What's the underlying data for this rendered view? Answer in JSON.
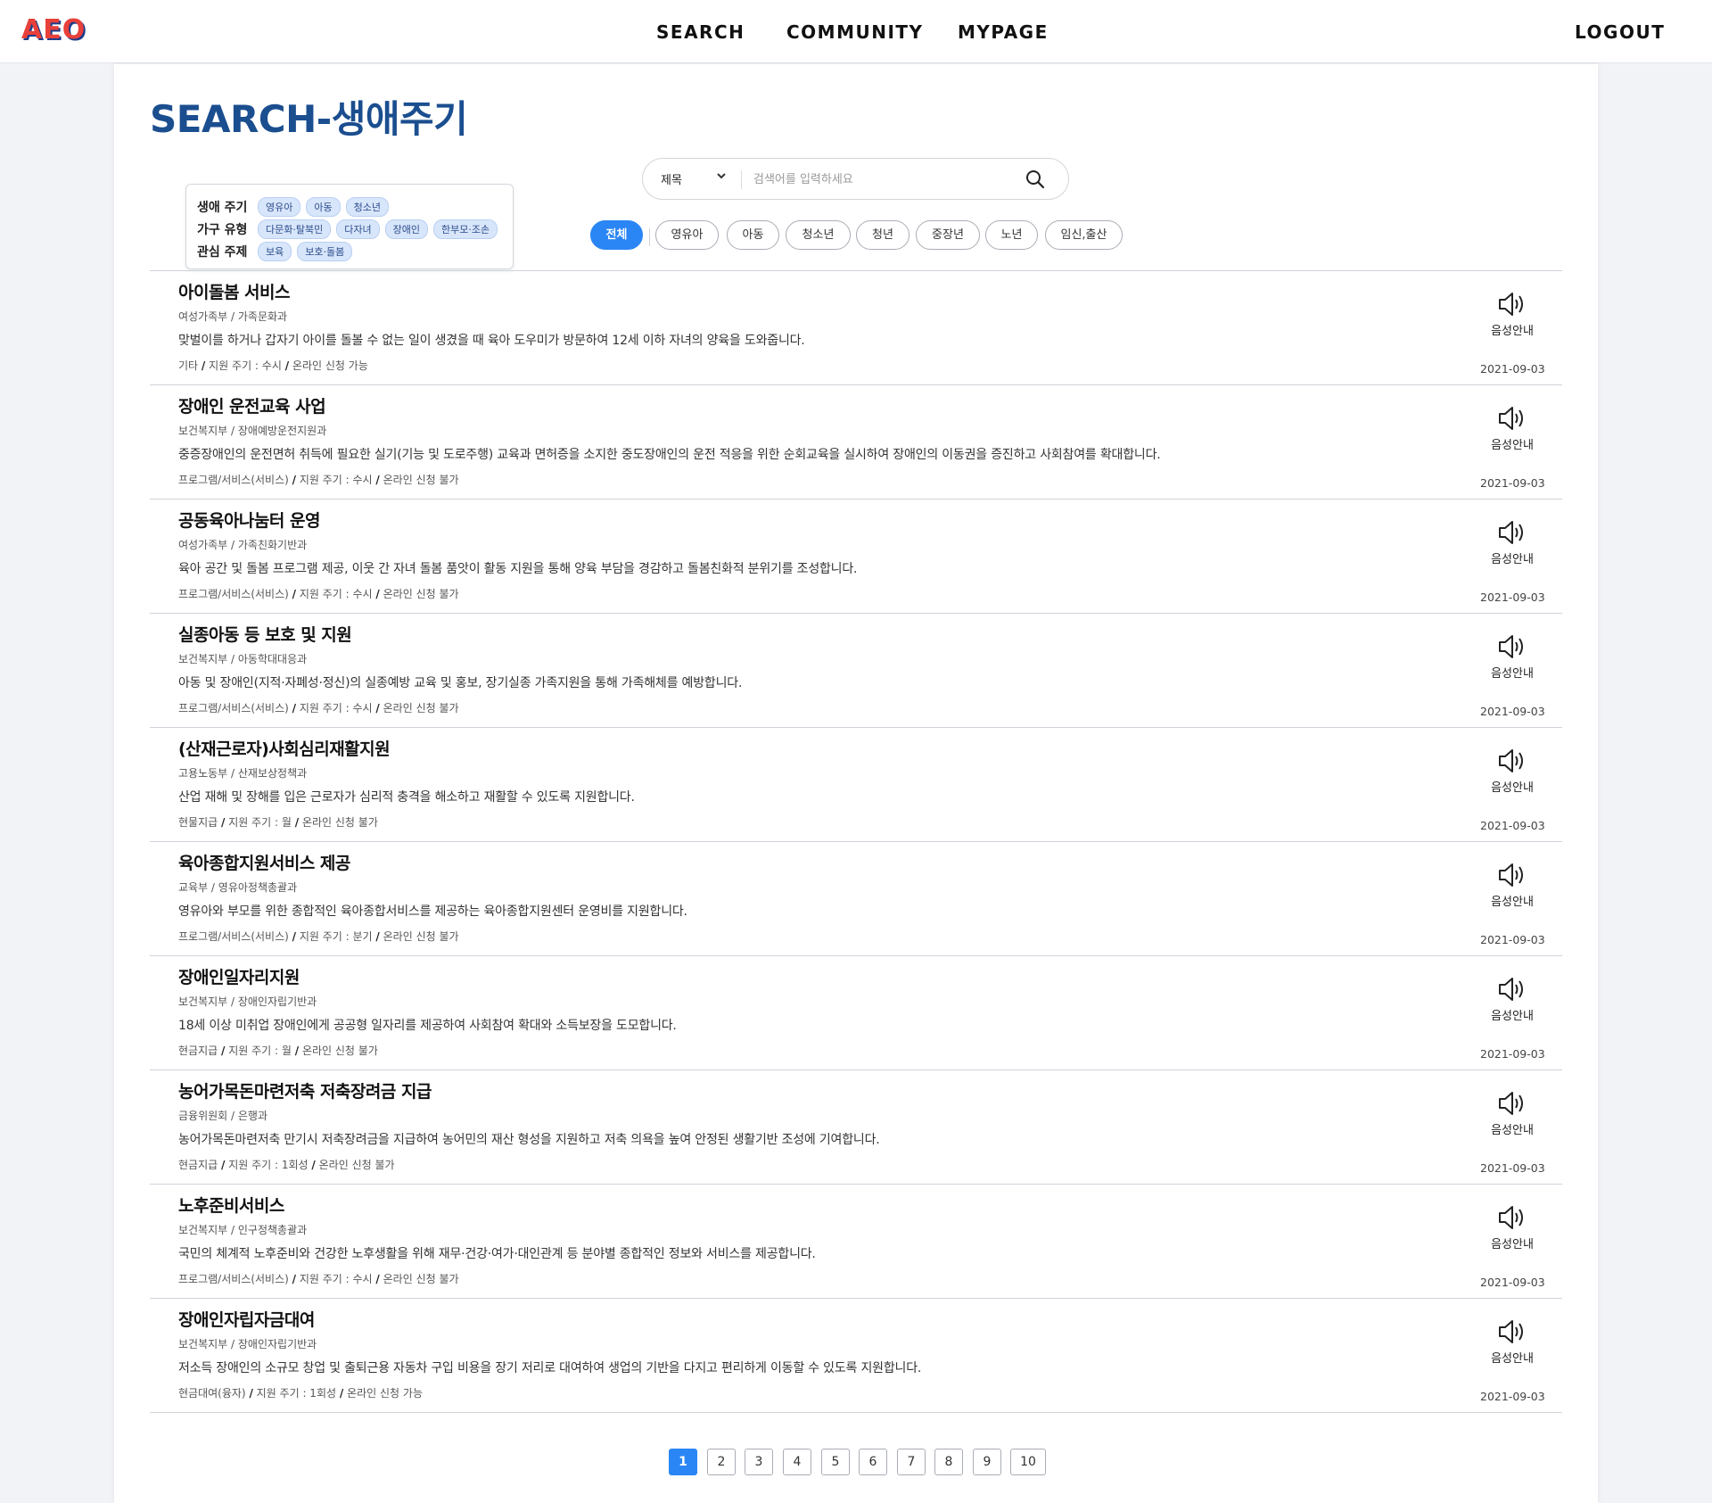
{
  "header": {
    "logo": "AEO",
    "nav": {
      "search": "SEARCH",
      "community": "COMMUNITY",
      "mypage": "MYPAGE",
      "logout": "LOGOUT"
    }
  },
  "page": {
    "title": "SEARCH-생애주기"
  },
  "filter_card": {
    "rows": [
      {
        "label": "생애 주기",
        "tags": [
          "영유아",
          "아동",
          "청소년"
        ]
      },
      {
        "label": "가구 유형",
        "tags": [
          "다문화·탈북민",
          "다자녀",
          "장애인",
          "한부모·조손"
        ]
      },
      {
        "label": "관심 주제",
        "tags": [
          "보육",
          "보호·돌봄"
        ]
      }
    ]
  },
  "search": {
    "select_value": "제목",
    "placeholder": "검색어를 입력하세요"
  },
  "categories": [
    "전체",
    "영유아",
    "아동",
    "청소년",
    "청년",
    "중장년",
    "노년",
    "임신,출산"
  ],
  "active_category": "전체",
  "voice_label": "음성안내",
  "results": [
    {
      "title": "아이돌봄 서비스",
      "dept": "여성가족부 / 가족문화과",
      "desc": "맞벌이를 하거나 갑자기 아이를 돌볼 수 없는 일이 생겼을 때 육아 도우미가 방문하여 12세 이하 자녀의 양육을 도와줍니다.",
      "type": "기타",
      "cycle": "지원 주기 : 수시",
      "online": "온라인 신청 가능",
      "date": "2021-09-03"
    },
    {
      "title": "장애인 운전교육 사업",
      "dept": "보건복지부 / 장애예방운전지원과",
      "desc": "중증장애인의 운전면허 취득에 필요한 실기(기능 및 도로주행) 교육과 면허증을 소지한 중도장애인의 운전 적응을 위한 순회교육을 실시하여 장애인의 이동권을 증진하고 사회참여를 확대합니다.",
      "type": "프로그램/서비스(서비스)",
      "cycle": "지원 주기 : 수시",
      "online": "온라인 신청 불가",
      "date": "2021-09-03"
    },
    {
      "title": "공동육아나눔터 운영",
      "dept": "여성가족부 / 가족친화기반과",
      "desc": "육아 공간 및 돌봄 프로그램 제공, 이웃 간 자녀 돌봄 품앗이 활동 지원을 통해 양육 부담을 경감하고 돌봄친화적 분위기를 조성합니다.",
      "type": "프로그램/서비스(서비스)",
      "cycle": "지원 주기 : 수시",
      "online": "온라인 신청 불가",
      "date": "2021-09-03"
    },
    {
      "title": "실종아동 등 보호 및 지원",
      "dept": "보건복지부 / 아동학대대응과",
      "desc": "아동 및 장애인(지적·자폐성·정신)의 실종예방 교육 및 홍보, 장기실종 가족지원을 통해 가족해체를 예방합니다.",
      "type": "프로그램/서비스(서비스)",
      "cycle": "지원 주기 : 수시",
      "online": "온라인 신청 불가",
      "date": "2021-09-03"
    },
    {
      "title": "(산재근로자)사회심리재활지원",
      "dept": "고용노동부 / 산재보상정책과",
      "desc": "산업 재해 및 장해를 입은 근로자가 심리적 충격을 해소하고 재활할 수 있도록 지원합니다.",
      "type": "현물지급",
      "cycle": "지원 주기 : 월",
      "online": "온라인 신청 불가",
      "date": "2021-09-03"
    },
    {
      "title": "육아종합지원서비스 제공",
      "dept": "교육부 / 영유아정책총괄과",
      "desc": "영유아와 부모를 위한 종합적인 육아종합서비스를 제공하는 육아종합지원센터 운영비를 지원합니다.",
      "type": "프로그램/서비스(서비스)",
      "cycle": "지원 주기 : 분기",
      "online": "온라인 신청 불가",
      "date": "2021-09-03"
    },
    {
      "title": "장애인일자리지원",
      "dept": "보건복지부 / 장애인자립기반과",
      "desc": "18세 이상 미취업 장애인에게 공공형 일자리를 제공하여 사회참여 확대와 소득보장을 도모합니다.",
      "type": "현금지급",
      "cycle": "지원 주기 : 월",
      "online": "온라인 신청 불가",
      "date": "2021-09-03"
    },
    {
      "title": "농어가목돈마련저축 저축장려금 지급",
      "dept": "금융위원회 / 은행과",
      "desc": "농어가목돈마련저축 만기시 저축장려금을 지급하여 농어민의 재산 형성을 지원하고 저축 의욕을 높여 안정된 생활기반 조성에 기여합니다.",
      "type": "현금지급",
      "cycle": "지원 주기 : 1회성",
      "online": "온라인 신청 불가",
      "date": "2021-09-03"
    },
    {
      "title": "노후준비서비스",
      "dept": "보건복지부 / 인구정책총괄과",
      "desc": "국민의 체계적 노후준비와 건강한 노후생활을 위해 재무·건강·여가·대인관계 등 분야별 종합적인 정보와 서비스를 제공합니다.",
      "type": "프로그램/서비스(서비스)",
      "cycle": "지원 주기 : 수시",
      "online": "온라인 신청 불가",
      "date": "2021-09-03"
    },
    {
      "title": "장애인자립자금대여",
      "dept": "보건복지부 / 장애인자립기반과",
      "desc": "저소득 장애인의 소규모 창업 및 출퇴근용 자동차 구입 비용을 장기 저리로 대여하여 생업의 기반을 다지고 편리하게 이동할 수 있도록 지원합니다.",
      "type": "현금대여(융자)",
      "cycle": "지원 주기 : 1회성",
      "online": "온라인 신청 가능",
      "date": "2021-09-03"
    }
  ],
  "pagination": {
    "pages": [
      "1",
      "2",
      "3",
      "4",
      "5",
      "6",
      "7",
      "8",
      "9",
      "10"
    ],
    "current": "1"
  },
  "colors": {
    "accent": "#2b86f5",
    "title": "#1b4e8f",
    "logo_red": "#e8403a",
    "logo_blue": "#1b3d8c"
  }
}
